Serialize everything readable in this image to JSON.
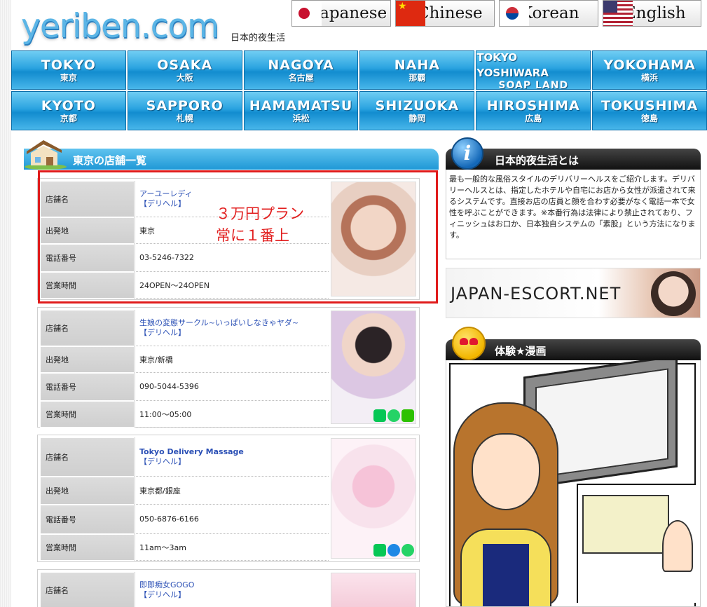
{
  "site": {
    "logo": "yeriben.com",
    "tagline": "日本的夜生活"
  },
  "languages": [
    {
      "label": "Japanese",
      "flag": "japan-flag-icon"
    },
    {
      "label": "Chinese",
      "flag": "china-flag-icon"
    },
    {
      "label": "Korean",
      "flag": "korea-flag-icon"
    },
    {
      "label": "English",
      "flag": "usa-flag-icon"
    }
  ],
  "nav": {
    "row1": [
      {
        "en": "TOKYO",
        "jp": "東京"
      },
      {
        "en": "OSAKA",
        "jp": "大阪"
      },
      {
        "en": "NAGOYA",
        "jp": "名古屋"
      },
      {
        "en": "NAHA",
        "jp": "那覇"
      },
      {
        "en": "TOKYO YOSHIWARA",
        "jp": "SOAP LAND"
      },
      {
        "en": "YOKOHAMA",
        "jp": "横浜"
      }
    ],
    "row2": [
      {
        "en": "KYOTO",
        "jp": "京都"
      },
      {
        "en": "SAPPORO",
        "jp": "札幌"
      },
      {
        "en": "HAMAMATSU",
        "jp": "浜松"
      },
      {
        "en": "SHIZUOKA",
        "jp": "静岡"
      },
      {
        "en": "HIROSHIMA",
        "jp": "広島"
      },
      {
        "en": "TOKUSHIMA",
        "jp": "徳島"
      }
    ]
  },
  "list": {
    "title": "東京の店舗一覧",
    "labels": {
      "name": "店舗名",
      "origin": "出発地",
      "phone": "電話番号",
      "hours": "営業時間"
    },
    "shops": [
      {
        "name": "アーユーレディ",
        "type": "【デリヘル】",
        "origin": "東京",
        "phone": "03-5246-7322",
        "hours": "24OPEN～24OPEN"
      },
      {
        "name": "生娘の変態サークル~いっぱいしなきゃヤダ~",
        "type": "【デリヘル】",
        "origin": "東京/新橋",
        "phone": "090-5044-5396",
        "hours": "11:00～05:00"
      },
      {
        "name": "Tokyo Delivery Massage",
        "type": "【デリヘル】",
        "origin": "東京都/銀座",
        "phone": "050-6876-6166",
        "hours": "11am～3am"
      },
      {
        "name": "即即痴女GOGO",
        "type": "【デリヘル】",
        "origin": "",
        "phone": "",
        "hours": ""
      }
    ],
    "annotation": {
      "line1": "３万円プラン",
      "line2": "常に１番上"
    }
  },
  "sidebar": {
    "about_title": "日本的夜生活とは",
    "about_text": "最も一般的な風俗スタイルのデリバリーヘルスをご紹介します。デリバリーヘルスとは、指定したホテルや自宅にお店から女性が派遣されて来るシステムです。直接お店の店員と顔を合わす必要がなく電話一本で女性を呼ぶことができます。※本番行為は法律により禁止されており、フィニッシュはお口か、日本独自システムの「素股」という方法になります。",
    "banner_text": "JAPAN-ESCORT.NET",
    "manga_title": "体験★漫画"
  }
}
